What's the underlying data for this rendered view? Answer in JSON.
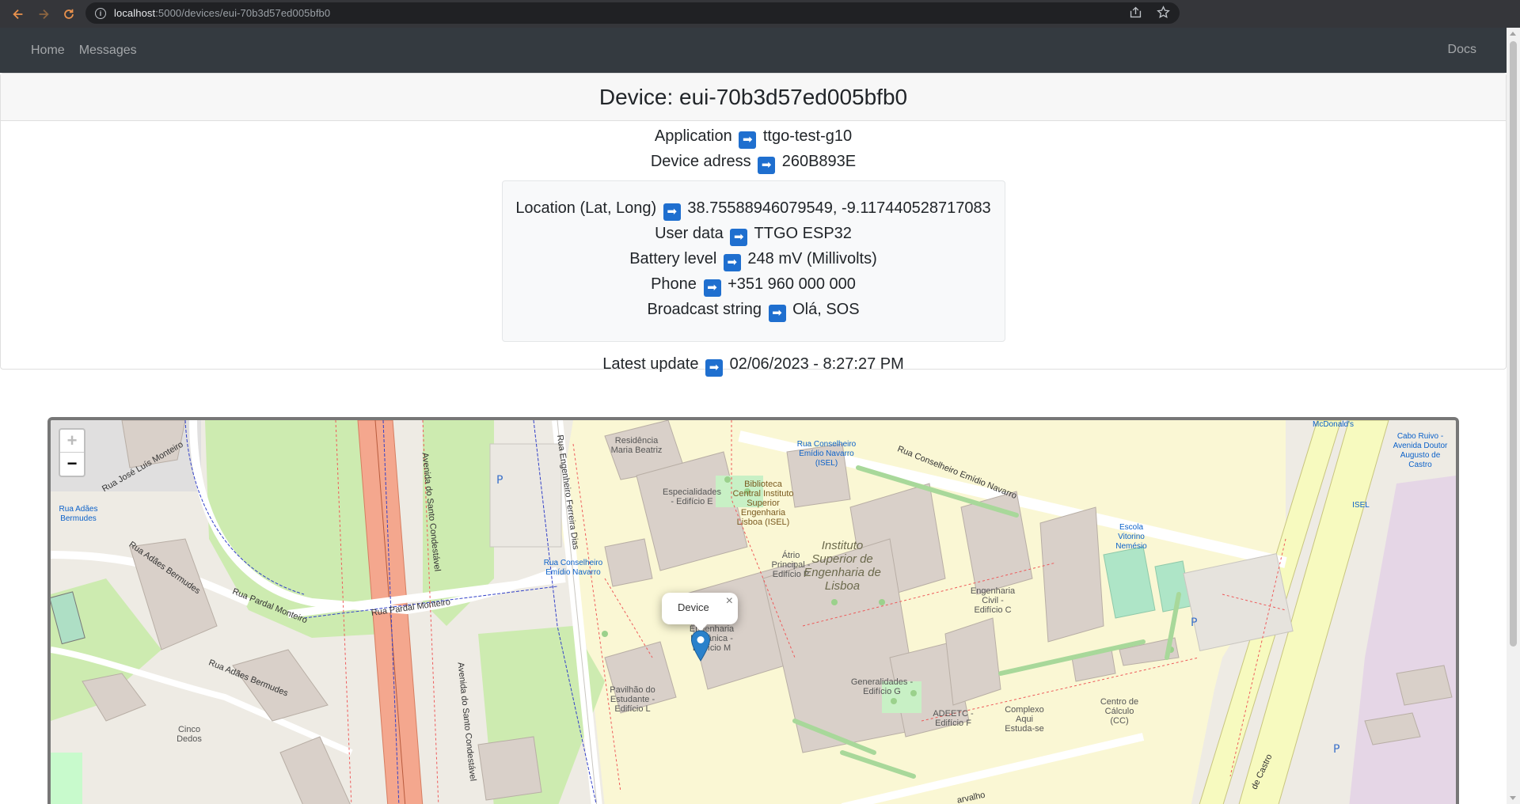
{
  "browser": {
    "url_host": "localhost",
    "url_path": ":5000/devices/eui-70b3d57ed005bfb0"
  },
  "nav": {
    "home": "Home",
    "messages": "Messages",
    "docs": "Docs"
  },
  "device": {
    "title": "Device: eui-70b3d57ed005bfb0",
    "application_label": "Application",
    "application_value": "ttgo-test-g10",
    "address_label": "Device adress",
    "address_value": "260B893E",
    "location_label": "Location (Lat, Long)",
    "location_value": "38.75588946079549, -9.117440528717083",
    "userdata_label": "User data",
    "userdata_value": "TTGO ESP32",
    "battery_label": "Battery level",
    "battery_value": "248 mV (Millivolts)",
    "phone_label": "Phone",
    "phone_value": "+351 960 000 000",
    "broadcast_label": "Broadcast string",
    "broadcast_value": "Olá, SOS",
    "latest_label": "Latest update",
    "latest_value": "02/06/2023 - 8:27:27 PM",
    "arrow_glyph": "➡"
  },
  "map": {
    "zoom_in": "+",
    "zoom_out": "−",
    "popup_text": "Device",
    "popup_close": "×",
    "labels": {
      "residencia": "Residência Maria Beatriz",
      "especialidades": "Especialidades - Edifício E",
      "biblioteca": "Biblioteca Central Instituto Superior Engenharia Lisboa (ISEL)",
      "atrio": "Átrio Principal - Edifício P",
      "instituto": "Instituto Superior de Engenharia de Lisboa",
      "eng_civil": "Engenharia Civil - Edifício C",
      "eng_mecanica": "Engenharia Mecânica - Edifício M",
      "pavilhao": "Pavilhão do Estudante - Edifício L",
      "generalidades": "Generalidades - Edifício G",
      "adeetc": "ADEETC - Edifício F",
      "complexo": "Complexo Aqui Estuda-se",
      "centro_calculo": "Centro de Cálculo (CC)",
      "cinco_dedos": "Cinco Dedos",
      "stop_emidio_1": "Rua Conselheiro Emídio Navarro (ISEL)",
      "stop_emidio_2": "Rua Conselheiro Emídio Navarro",
      "stop_adaes": "Rua Adães Bermudes",
      "escola": "Escola Vitorino Nemésio",
      "cabo_ruivo": "Cabo Ruivo - Avenida Doutor Augusto de Castro",
      "mcdonalds": "McDonald's",
      "isel": "ISEL"
    },
    "roads": {
      "jose_luis": "Rua José Luís Monteiro",
      "adaes": "Rua Adães Bermudes",
      "pardal": "Rua Pardal Monteiro",
      "santo_condestavel": "Avenida do Santo Condestável",
      "ferreira_dias": "Rua Engenheiro Ferreira Dias",
      "emidio_navarro": "Rua Conselheiro Emídio Navarro",
      "de_castro": "de Castro",
      "carvalho": "arvalho"
    }
  }
}
